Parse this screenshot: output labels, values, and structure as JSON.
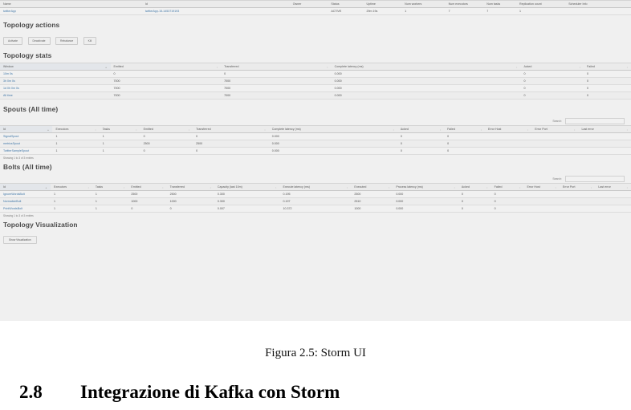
{
  "document": {
    "figure_caption": "Figura 2.5: Storm UI",
    "section_number": "2.8",
    "section_title": "Integrazione di Kafka con Storm"
  },
  "storm_ui": {
    "topology_summary": {
      "columns": [
        "Name",
        "Id",
        "Owner",
        "Status",
        "Uptime",
        "Num workers",
        "Num executors",
        "Num tasks",
        "Replication count",
        "Scheduler Info"
      ],
      "rows": [
        [
          "twitterApp",
          "twitterApp-15-1453719193",
          "",
          "ACTIVE",
          "29m 19s",
          "1",
          "7",
          "7",
          "1",
          ""
        ]
      ]
    },
    "topology_actions": {
      "title": "Topology actions",
      "buttons": [
        "Activate",
        "Deactivate",
        "Rebalance",
        "Kill"
      ]
    },
    "topology_stats": {
      "title": "Topology stats",
      "columns": [
        "Window",
        "Emitted",
        "Transferred",
        "Complete latency (ms)",
        "Acked",
        "Failed"
      ],
      "rows": [
        [
          "10m 0s",
          "0",
          "0",
          "0.000",
          "0",
          "0"
        ],
        [
          "3h 0m 0s",
          "7000",
          "7000",
          "0.000",
          "0",
          "0"
        ],
        [
          "1d 0h 0m 0s",
          "7000",
          "7000",
          "0.000",
          "0",
          "0"
        ],
        [
          "All time",
          "7000",
          "7000",
          "0.000",
          "0",
          "0"
        ]
      ]
    },
    "spouts": {
      "title": "Spouts (All time)",
      "search_label": "Search:",
      "columns": [
        "Id",
        "Executors",
        "Tasks",
        "Emitted",
        "Transferred",
        "Complete latency (ms)",
        "Acked",
        "Failed",
        "Error Host",
        "Error Port",
        "Last error"
      ],
      "rows": [
        [
          "SignalSpout",
          "1",
          "1",
          "0",
          "0",
          "0.000",
          "0",
          "0",
          "",
          "",
          ""
        ],
        [
          "metricsSpout",
          "1",
          "1",
          "2500",
          "2500",
          "0.000",
          "0",
          "0",
          "",
          "",
          ""
        ],
        [
          "TwitterSampleSpout",
          "1",
          "1",
          "0",
          "0",
          "0.000",
          "0",
          "0",
          "",
          "",
          ""
        ]
      ],
      "showing": "Showing 1 to 3 of 3 entries"
    },
    "bolts": {
      "title": "Bolts (All time)",
      "search_label": "Search:",
      "columns": [
        "Id",
        "Executors",
        "Tasks",
        "Emitted",
        "Transferred",
        "Capacity (last 10m)",
        "Execute latency (ms)",
        "Executed",
        "Process latency (ms)",
        "Acked",
        "Failed",
        "Error Host",
        "Error Port",
        "Last error"
      ],
      "rows": [
        [
          "IgnoreWordsBolt",
          "1",
          "1",
          "2500",
          "2500",
          "0.300",
          "0.195",
          "2500",
          "0.000",
          "0",
          "0",
          "",
          "",
          ""
        ],
        [
          "NormalizeBolt",
          "1",
          "1",
          "1000",
          "1000",
          "0.300",
          "0.197",
          "2510",
          "0.000",
          "0",
          "0",
          "",
          "",
          ""
        ],
        [
          "PrintWordsBolt",
          "1",
          "1",
          "0",
          "0",
          "0.007",
          "10.372",
          "1000",
          "0.000",
          "0",
          "0",
          "",
          "",
          ""
        ]
      ],
      "showing": "Showing 1 to 3 of 3 entries"
    },
    "visualization": {
      "title": "Topology Visualization",
      "button": "Show Visualization"
    },
    "sort_icon": "↕",
    "sort_asc_icon": "▲"
  }
}
